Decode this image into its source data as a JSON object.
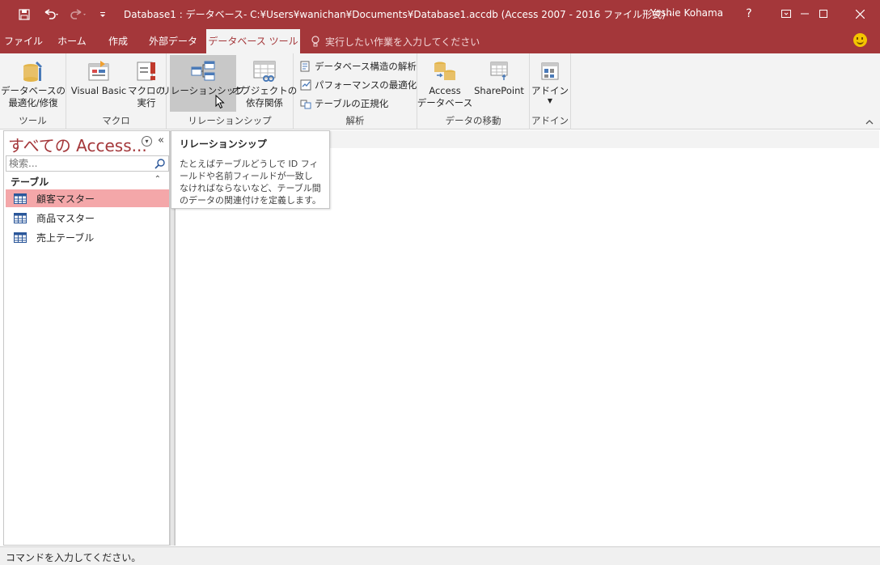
{
  "window": {
    "title": "Database1 : データベース- C:¥Users¥wanichan¥Documents¥Database1.accdb (Access 2007 - 2016 ファイル形式)···",
    "user": "Yoshie Kohama",
    "help": "?",
    "minimize": "—",
    "restore": "☐",
    "close": "✕"
  },
  "tabs": [
    {
      "label": "ファイル"
    },
    {
      "label": "ホーム"
    },
    {
      "label": "作成"
    },
    {
      "label": "外部データ"
    },
    {
      "label": "データベース ツール"
    }
  ],
  "tell_me": "実行したい作業を入力してください",
  "ribbon": {
    "groups": {
      "tools": {
        "label": "ツール",
        "buttons": {
          "compact": "データベースの\n最適化/修復"
        }
      },
      "macro": {
        "label": "マクロ",
        "buttons": {
          "vba": "Visual Basic",
          "run": "マクロの\n実行"
        }
      },
      "relationships": {
        "label": "リレーションシップ",
        "buttons": {
          "relationships": "リレーションシップ",
          "dependencies": "オブジェクトの\n依存関係"
        }
      },
      "analyze": {
        "label": "解析",
        "buttons": {
          "documenter": "データベース構造の解析",
          "performance": "パフォーマンスの最適化",
          "table": "テーブルの正規化"
        }
      },
      "move": {
        "label": "データの移動",
        "buttons": {
          "access": "Access\nデータベース",
          "sharepoint": "SharePoint"
        }
      },
      "addins": {
        "label": "アドイン",
        "buttons": {
          "addins": "アドイン"
        }
      }
    }
  },
  "nav": {
    "title": "すべての Access...",
    "search_placeholder": "検索...",
    "section": "テーブル",
    "items": [
      {
        "label": "顧客マスター",
        "selected": true
      },
      {
        "label": "商品マスター",
        "selected": false
      },
      {
        "label": "売上テーブル",
        "selected": false
      }
    ]
  },
  "tooltip": {
    "title": "リレーションシップ",
    "body": "たとえばテーブルどうしで ID フィールドや名前フィールドが一致しなければならないなど、テーブル間のデータの関連付けを定義します。"
  },
  "status": "コマンドを入力してください。",
  "colors": {
    "brand": "#a4373a",
    "selected_item": "#f4a7a9"
  }
}
